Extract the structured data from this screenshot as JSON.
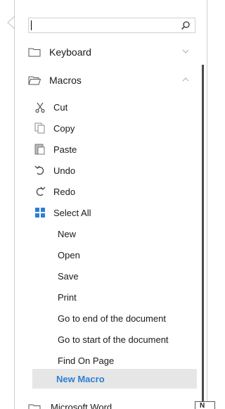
{
  "search": {
    "value": "",
    "placeholder": ""
  },
  "groups": {
    "keyboard": {
      "label": "Keyboard",
      "icon": "folder-icon",
      "expanded": false
    },
    "macros": {
      "label": "Macros",
      "icon": "folder-icon",
      "expanded": true
    },
    "microsoft_word": {
      "label": "Microsoft Word",
      "icon": "folder-icon"
    }
  },
  "items": [
    {
      "label": "Cut",
      "icon": "scissors-icon"
    },
    {
      "label": "Copy",
      "icon": "copy-icon"
    },
    {
      "label": "Paste",
      "icon": "paste-icon"
    },
    {
      "label": "Undo",
      "icon": "undo-icon"
    },
    {
      "label": "Redo",
      "icon": "redo-icon"
    },
    {
      "label": "Select All",
      "icon": "select-all-icon"
    },
    {
      "label": "New"
    },
    {
      "label": "Open"
    },
    {
      "label": "Save"
    },
    {
      "label": "Print"
    },
    {
      "label": "Go to end of the document"
    },
    {
      "label": "Go to start of the document"
    },
    {
      "label": "Find On Page"
    },
    {
      "label": "New Macro",
      "highlighted": true
    }
  ],
  "corner": {
    "text": "N"
  },
  "colors": {
    "highlight_bg": "#e6e6e6",
    "highlight_text": "#2a7fd4",
    "select_all_blue": "#2b7fd6"
  }
}
